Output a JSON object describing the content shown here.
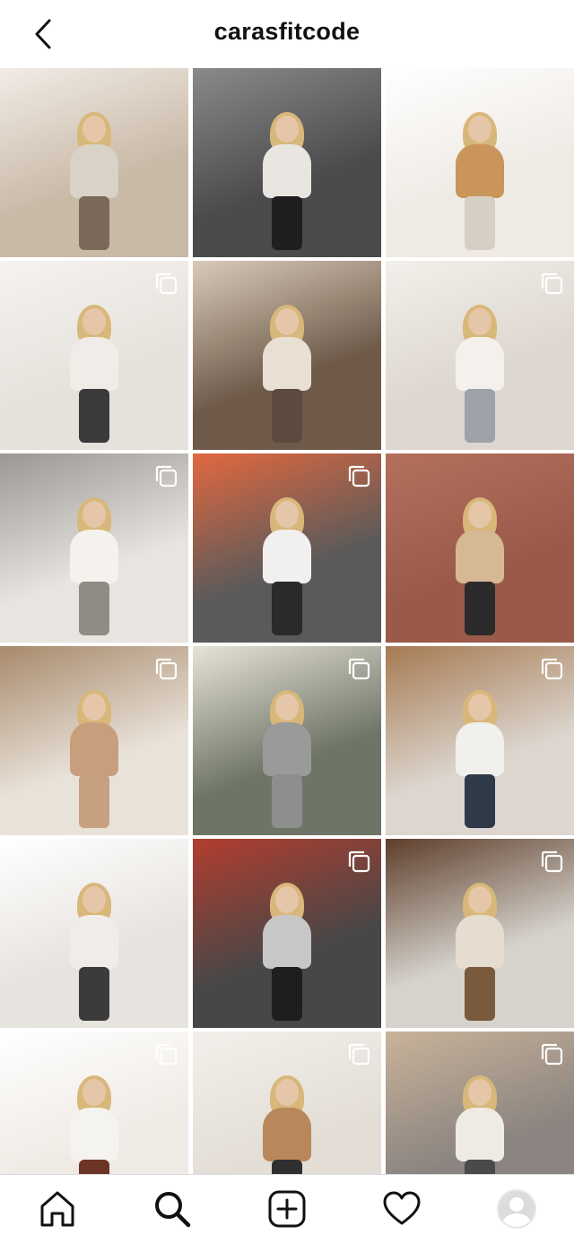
{
  "header": {
    "username": "carasfitcode",
    "back_icon": "chevron-left-icon"
  },
  "grid": {
    "rows": 6,
    "columns": 3,
    "posts": [
      {
        "id": "p1",
        "bg": "#c9b9a7",
        "accent": "#f1ece6",
        "shirt": "#d9d2c6",
        "pants": "#7b6a5a",
        "multi": false
      },
      {
        "id": "p2",
        "bg": "#4b4b4b",
        "accent": "#8a8a8a",
        "shirt": "#e9e6e2",
        "pants": "#1f1f1f",
        "multi": false
      },
      {
        "id": "p3",
        "bg": "#efeae4",
        "accent": "#ffffff",
        "shirt": "#c9955a",
        "pants": "#d8cfc4",
        "multi": false
      },
      {
        "id": "p4",
        "bg": "#e6e1db",
        "accent": "#f5f3f0",
        "shirt": "#f0ede8",
        "pants": "#3a3a3a",
        "multi": true
      },
      {
        "id": "p5",
        "bg": "#6f5a4a",
        "accent": "#d9cbb9",
        "shirt": "#e9dfd3",
        "pants": "#5b4a3d",
        "multi": false
      },
      {
        "id": "p6",
        "bg": "#ddd6cf",
        "accent": "#f3efea",
        "shirt": "#f4f1ec",
        "pants": "#9ea3a9",
        "multi": true
      },
      {
        "id": "p7",
        "bg": "#e8e4df",
        "accent": "#9a9893",
        "shirt": "#f5f2ee",
        "pants": "#8f8b85",
        "multi": true
      },
      {
        "id": "p8",
        "bg": "#5a5a5a",
        "accent": "#e2683f",
        "shirt": "#f2f0ee",
        "pants": "#2a2a2a",
        "multi": true
      },
      {
        "id": "p9",
        "bg": "#9a5a4a",
        "accent": "#b4705d",
        "shirt": "#d7b894",
        "pants": "#2b2b2b",
        "multi": false
      },
      {
        "id": "p10",
        "bg": "#e9e2d9",
        "accent": "#a88a6c",
        "shirt": "#c79f7d",
        "pants": "#c7a07f",
        "multi": true
      },
      {
        "id": "p11",
        "bg": "#6e7566",
        "accent": "#e8e2d8",
        "shirt": "#9a9a99",
        "pants": "#8e8e8e",
        "multi": true
      },
      {
        "id": "p12",
        "bg": "#dcd6cf",
        "accent": "#a67a52",
        "shirt": "#f2f0ed",
        "pants": "#2f3a48",
        "multi": true
      },
      {
        "id": "p13",
        "bg": "#e7e3de",
        "accent": "#ffffff",
        "shirt": "#f0ede9",
        "pants": "#3b3b3b",
        "multi": false
      },
      {
        "id": "p14",
        "bg": "#474747",
        "accent": "#b23d2f",
        "shirt": "#c7c7c7",
        "pants": "#1e1e1e",
        "multi": true
      },
      {
        "id": "p15",
        "bg": "#d6d3cd",
        "accent": "#5e3e2b",
        "shirt": "#e6ddd0",
        "pants": "#7a5a3d",
        "multi": true
      },
      {
        "id": "p16",
        "bg": "#efeae4",
        "accent": "#ffffff",
        "shirt": "#f5f3ef",
        "pants": "#6b3424",
        "multi": true
      },
      {
        "id": "p17",
        "bg": "#e3ddd6",
        "accent": "#f3efea",
        "shirt": "#b8885c",
        "pants": "#2f2f2f",
        "multi": true
      },
      {
        "id": "p18",
        "bg": "#8b8480",
        "accent": "#c9b39a",
        "shirt": "#eeeae4",
        "pants": "#4a4a4a",
        "multi": true
      }
    ]
  },
  "tab_bar": {
    "items": [
      {
        "name": "home",
        "icon": "home-icon"
      },
      {
        "name": "search",
        "icon": "search-icon",
        "active": true
      },
      {
        "name": "new-post",
        "icon": "plus-square-icon"
      },
      {
        "name": "activity",
        "icon": "heart-icon"
      },
      {
        "name": "profile",
        "icon": "avatar-icon"
      }
    ]
  }
}
